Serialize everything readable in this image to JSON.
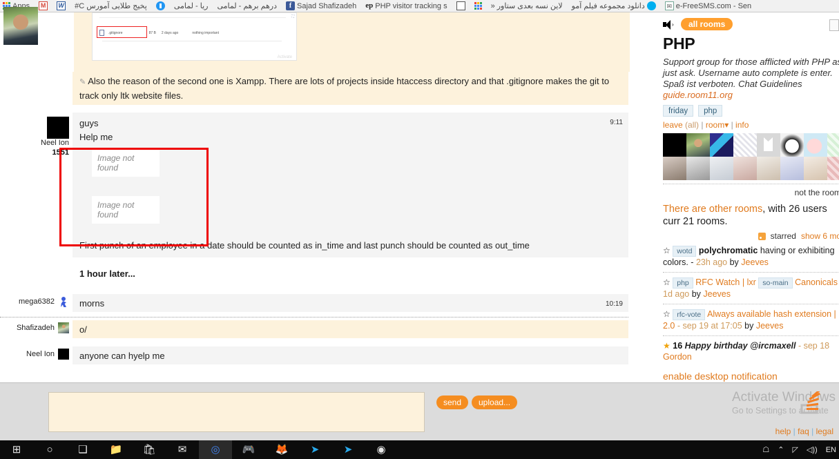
{
  "browser": {
    "bookmarks": [
      {
        "label": "Apps",
        "icon": "apps-grid-icon"
      },
      {
        "label": "",
        "icon": "gmail-icon"
      },
      {
        "label": "",
        "icon": "word-icon"
      },
      {
        "label": "پخیج طلایی آمورس C#",
        "icon": "none"
      },
      {
        "label": "",
        "icon": "blue-circle-icon"
      },
      {
        "label": "ریا - لمامی",
        "icon": "none"
      },
      {
        "label": "درهم برهم - لمامی",
        "icon": "none"
      },
      {
        "label": "Sajad Shafizadeh",
        "icon": "facebook-icon"
      },
      {
        "label": "PHP visitor tracking s",
        "icon": "ep-icon"
      },
      {
        "label": "",
        "icon": "empty-box-icon"
      },
      {
        "label": "",
        "icon": "apps-grid-icon"
      },
      {
        "label": "لاین نسه بعدی ستاور «",
        "icon": "none"
      },
      {
        "label": "دانلود مجموعه فیلم آمو",
        "icon": "skype-icon"
      },
      {
        "label": "e-FreeSMS.com - Sen",
        "icon": "sms-icon"
      }
    ]
  },
  "chat": {
    "embedded_screenshot": {
      "filename": ".gitignore",
      "size": "87 B",
      "age": "2 days ago",
      "commit_message": "nothing important",
      "watermark": "Activate"
    },
    "messages": [
      {
        "id": "msg-xampp-note",
        "author": "",
        "avatar": "none",
        "reputation": "",
        "time": "",
        "background": "cream",
        "edited": true,
        "text": "Also the reason of the second one is Xampp. There are lots of projects inside htaccess directory and that .gitignore makes the git to track only ltk website files."
      },
      {
        "id": "msg-help-me",
        "author": "Neel Ion",
        "avatar": "black",
        "reputation": "1551",
        "time": "9:11",
        "background": "grey",
        "lines": [
          "guys",
          "Help me"
        ],
        "images": [
          "Image not found",
          "Image not found"
        ],
        "footer_text": "First punch of an employee in a date should be counted as in_time and last punch should be counted as out_time"
      },
      {
        "id": "msg-morns",
        "author": "mega6382",
        "avatar": "mega",
        "time": "10:19",
        "background": "grey",
        "text": "morns"
      },
      {
        "id": "msg-wave",
        "author": "Shafizadeh",
        "avatar": "photo",
        "time": "",
        "background": "cream",
        "text": "o/"
      },
      {
        "id": "msg-anyone-help",
        "author": "Neel Ion",
        "avatar": "black",
        "time": "",
        "background": "grey",
        "text": "anyone can hyelp me"
      }
    ],
    "time_separator": "1 hour later..."
  },
  "sidebar": {
    "all_rooms_label": "all rooms",
    "room_title": "PHP",
    "room_description": "Support group for those afflicted with PHP ask, just ask. Username auto complete is enter. Spaß ist verboten. Chat Guidelines",
    "room_description_link": "guide.room11.org",
    "tags": [
      "friday",
      "php"
    ],
    "actions": {
      "leave": "leave",
      "all": "(all)",
      "room": "room",
      "room_caret": "▾",
      "info": "info"
    },
    "not_the_room": "not the room",
    "other_rooms": {
      "link": "There are other rooms",
      "rest": ", with 26 users curr 21 rooms."
    },
    "starred": {
      "label": "starred",
      "show_more": "show 6 mo"
    },
    "starred_items": [
      {
        "star": "☆",
        "tag": "wotd",
        "bold": "polychromatic",
        "text": " having or exhibiting colors. - ",
        "time": "23h ago",
        "by": "by ",
        "author": "Jeeves"
      },
      {
        "star": "☆",
        "tag": "php",
        "links": "RFC Watch | lxr",
        "tag2": "so-main",
        "links2": "Canonicals",
        "time": "1d ago",
        "by": "by ",
        "author": "Jeeves"
      },
      {
        "star": "☆",
        "tag": "rfc-vote",
        "links": "Always available hash extension |",
        "version": "2.0",
        "time": " - sep 19 at 17:05 ",
        "by": "by ",
        "author": "Jeeves"
      },
      {
        "star": "★",
        "count": "16",
        "bold_italic": "Happy birthday @ircmaxell",
        "time": " - sep 18",
        "author": "Gordon"
      }
    ],
    "enable_notification": "enable desktop notification"
  },
  "composer": {
    "input_value": "",
    "input_placeholder": "",
    "send_label": "send",
    "upload_label": "upload..."
  },
  "watermark": {
    "title": "Activate Windows",
    "subtitle": "Go to Settings to activate"
  },
  "footer": {
    "help": "help",
    "faq": "faq",
    "legal": "legal"
  },
  "taskbar": {
    "items": [
      {
        "name": "start-button",
        "glyph": "⊞"
      },
      {
        "name": "search-icon",
        "glyph": "○"
      },
      {
        "name": "task-view-icon",
        "glyph": "❑"
      },
      {
        "name": "file-explorer-icon",
        "glyph": "📁"
      },
      {
        "name": "store-icon",
        "glyph": "🛍"
      },
      {
        "name": "mail-icon",
        "glyph": "✉"
      },
      {
        "name": "chrome-icon",
        "glyph": "◎"
      },
      {
        "name": "game-icon",
        "glyph": "🎮"
      },
      {
        "name": "firefox-icon",
        "glyph": "🦊"
      },
      {
        "name": "telegram-icon",
        "glyph": "➤"
      },
      {
        "name": "telegram2-icon",
        "glyph": "➤"
      },
      {
        "name": "camera-icon",
        "glyph": "◉"
      }
    ],
    "tray": [
      {
        "name": "person-icon",
        "glyph": "☖"
      },
      {
        "name": "show-hidden-icon",
        "glyph": "⌃"
      },
      {
        "name": "network-icon",
        "glyph": "◸"
      },
      {
        "name": "volume-icon",
        "glyph": "◁))"
      },
      {
        "name": "language-indicator",
        "glyph": "EN"
      }
    ]
  },
  "colors": {
    "orange": "#e07b1f",
    "pill_orange": "#ff9f2e",
    "cream": "#fdf2dc",
    "grey_msg": "#f4f4f4",
    "annotation_red": "#ee0000"
  }
}
